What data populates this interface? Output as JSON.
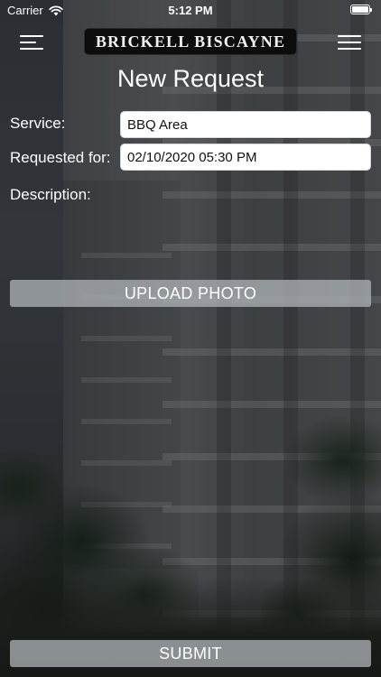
{
  "status_bar": {
    "carrier": "Carrier",
    "time": "5:12 PM"
  },
  "header": {
    "logo_text": "BRICKELL BISCAYNE",
    "left_icon": "hamburger-menu-icon",
    "right_icon": "options-menu-icon"
  },
  "page_title": "New Request",
  "form": {
    "service_label": "Service:",
    "service_value": "BBQ Area",
    "requested_for_label": "Requested for:",
    "requested_for_value": "02/10/2020 05:30 PM",
    "description_label": "Description:",
    "description_value": ""
  },
  "upload_button": "UPLOAD PHOTO",
  "submit_button": "SUBMIT",
  "colors": {
    "button_bg": "#aaafb4",
    "overlay": "#000000",
    "logo_bg": "#0d0d0d"
  }
}
